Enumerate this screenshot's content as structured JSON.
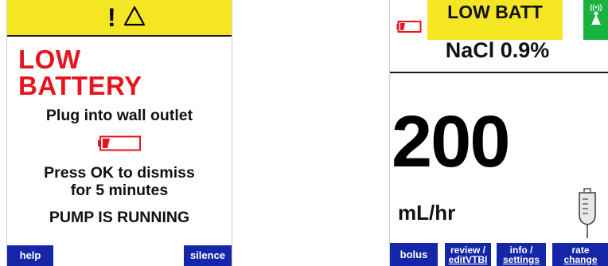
{
  "left_screen": {
    "alert_symbol": "!",
    "alert_icon": "warning-triangle-icon",
    "title_line1": "LOW",
    "title_line2": "BATTERY",
    "instruction": "Plug into wall outlet",
    "battery_icon": "battery-low-icon",
    "dismiss_line1": "Press OK to dismiss",
    "dismiss_line2": "for 5 minutes",
    "status": "PUMP IS RUNNING",
    "softkeys": {
      "help": "help",
      "silence": "silence"
    },
    "colors": {
      "alert_bar": "#f5e623",
      "title": "#e8131b",
      "softkey": "#1626a8"
    }
  },
  "right_screen": {
    "battery_icon": "battery-low-icon",
    "banner": "LOW BATT",
    "drug": "NaCl 0.9%",
    "wireless_icon": "wireless-signal-icon",
    "wireless_symbol": "((•))",
    "rate_value": "200",
    "rate_units": "mL/hr",
    "bag_icon": "iv-bag-icon",
    "softkeys": {
      "bolus": "bolus",
      "review_line1": "review /",
      "review_line2": "editVTBI",
      "info_line1": "info /",
      "info_line2": "settings",
      "rate_line1": "rate",
      "rate_line2": "change"
    },
    "colors": {
      "banner": "#f5e623",
      "wireless": "#19b23e",
      "softkey": "#1626a8"
    }
  }
}
